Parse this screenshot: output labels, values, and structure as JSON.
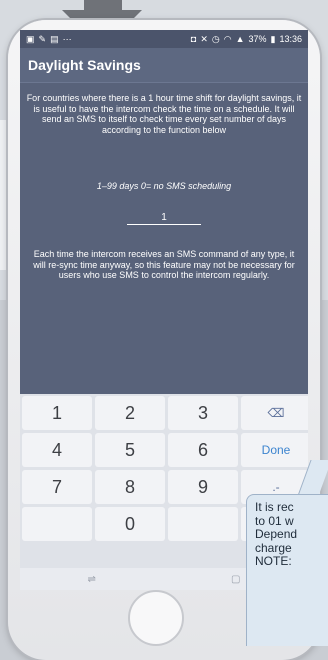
{
  "status_bar": {
    "left_icons": [
      "image-icon",
      "edit-icon",
      "message-icon",
      "more-icon"
    ],
    "right_icons": [
      "nfc-icon",
      "mute-icon",
      "alarm-icon",
      "wifi-icon",
      "signal-icon"
    ],
    "battery": "37%",
    "time": "13:36"
  },
  "app_bar": {
    "title": "Daylight Savings"
  },
  "description": "For countries where there is a 1 hour time shift for daylight savings, it is useful to have the intercom check the time on a schedule. It will send an SMS to itself to check time every set number of days according to the function below",
  "range_hint": "1–99 days 0= no SMS scheduling",
  "days_input": {
    "value": "1"
  },
  "note": "Each time the intercom receives an SMS command of any type, it will re-sync time anyway, so this feature may not be necessary for users who use SMS to control the intercom regularly.",
  "keyboard": {
    "rows": [
      [
        "1",
        "2",
        "3",
        "⌫"
      ],
      [
        "4",
        "5",
        "6",
        "Done"
      ],
      [
        "7",
        "8",
        "9",
        ".-"
      ],
      [
        "",
        "0",
        "",
        ""
      ]
    ]
  },
  "nav_bar": {
    "back": "⇌",
    "home": "▢"
  },
  "callout": {
    "lines": [
      "It is rec",
      "to 01 w",
      "Depend",
      "charge",
      "NOTE:"
    ]
  }
}
